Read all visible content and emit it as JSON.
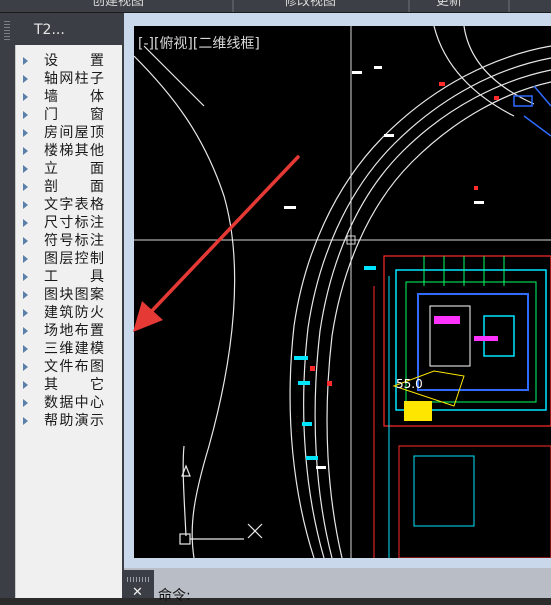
{
  "ribbon": {
    "items": [
      {
        "label": "创建视图"
      },
      {
        "label": "修改视图"
      },
      {
        "label": "更新"
      }
    ]
  },
  "palette": {
    "title": "T2...",
    "items": [
      {
        "label": "设　　置"
      },
      {
        "label": "轴网柱子"
      },
      {
        "label": "墙　　体"
      },
      {
        "label": "门　　窗"
      },
      {
        "label": "房间屋顶"
      },
      {
        "label": "楼梯其他"
      },
      {
        "label": "立　　面"
      },
      {
        "label": "剖　　面"
      },
      {
        "label": "文字表格"
      },
      {
        "label": "尺寸标注"
      },
      {
        "label": "符号标注"
      },
      {
        "label": "图层控制"
      },
      {
        "label": "工　　具"
      },
      {
        "label": "图块图案"
      },
      {
        "label": "建筑防火"
      },
      {
        "label": "场地布置"
      },
      {
        "label": "三维建模"
      },
      {
        "label": "文件布图"
      },
      {
        "label": "其　　它"
      },
      {
        "label": "数据中心"
      },
      {
        "label": "帮助演示"
      }
    ]
  },
  "viewport": {
    "label": "[-][俯视][二维线框]",
    "annotation": "55.0"
  },
  "command": {
    "label": "命令:"
  },
  "colors": {
    "arrow": "#e53935",
    "canvas_bg": "#000000",
    "panel_bg": "#f0f0f0"
  }
}
